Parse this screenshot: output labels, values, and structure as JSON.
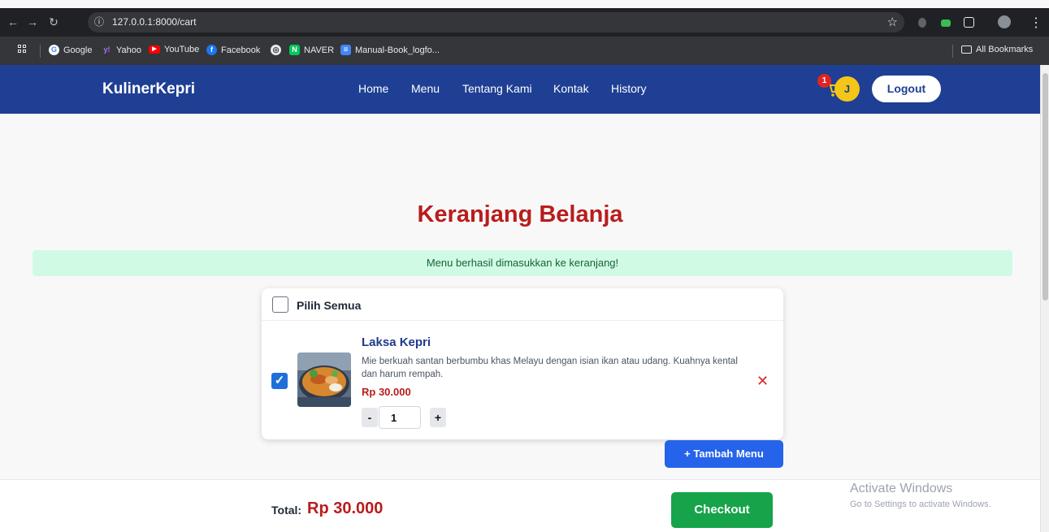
{
  "browser": {
    "url": "127.0.0.1:8000/cart",
    "bookmarks": [
      {
        "label": "Google",
        "icon": "google-icon",
        "color": "#4285f4"
      },
      {
        "label": "Yahoo",
        "icon": "yahoo-icon",
        "color": "#6001d2"
      },
      {
        "label": "YouTube",
        "icon": "youtube-icon",
        "color": "#ff0000"
      },
      {
        "label": "Facebook",
        "icon": "facebook-icon",
        "color": "#1877f2"
      },
      {
        "label": "",
        "icon": "globe-icon",
        "color": "#e8eaed"
      },
      {
        "label": "NAVER",
        "icon": "naver-icon",
        "color": "#03c75a"
      },
      {
        "label": "Manual-Book_logfo...",
        "icon": "docs-icon",
        "color": "#4285f4"
      }
    ],
    "all_bookmarks": "All Bookmarks"
  },
  "navbar": {
    "brand": "KulinerKepri",
    "links": [
      "Home",
      "Menu",
      "Tentang Kami",
      "Kontak",
      "History"
    ],
    "cart_count": "1",
    "avatar_initial": "J",
    "logout": "Logout",
    "color": "#1e3f93"
  },
  "page": {
    "title": "Keranjang Belanja",
    "alert": "Menu berhasil dimasukkan ke keranjang!"
  },
  "cart": {
    "select_all": "Pilih Semua",
    "items": [
      {
        "name": "Laksa Kepri",
        "description": "Mie berkuah santan berbumbu khas Melayu dengan isian ikan atau udang. Kuahnya kental dan harum rempah.",
        "price": "Rp 30.000",
        "quantity": "1",
        "checked": true
      }
    ],
    "add_menu": "+ Tambah Menu"
  },
  "footer": {
    "total_label": "Total:",
    "total_value": "Rp 30.000",
    "checkout": "Checkout"
  },
  "watermark": {
    "title": "Activate Windows",
    "subtitle": "Go to Settings to activate Windows."
  }
}
